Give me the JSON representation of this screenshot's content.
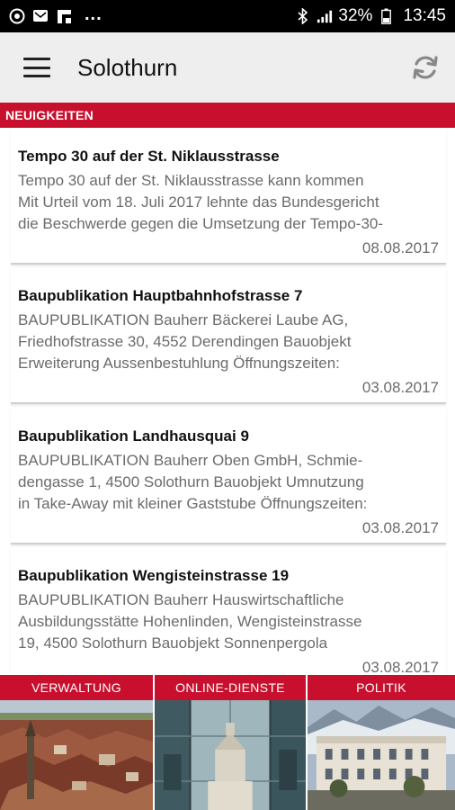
{
  "status_bar": {
    "battery": "32%",
    "time": "13:45",
    "more": "..."
  },
  "app_bar": {
    "title": "Solothurn"
  },
  "section": {
    "label": "NEUIGKEITEN"
  },
  "news": [
    {
      "title": "Tempo 30 auf der St. Niklausstrasse",
      "excerpt": [
        "Tempo 30 auf der St. Niklausstrasse kann kommen",
        "Mit Urteil vom 18. Juli 2017 lehnte das Bundesgericht",
        "die Beschwerde gegen die Umsetzung der Tempo-30-"
      ],
      "date": "08.08.2017"
    },
    {
      "title": "Baupublikation Hauptbahnhofstrasse 7",
      "excerpt": [
        "BAUPUBLIKATION  Bauherr Bäckerei Laube AG,",
        "Friedhofstrasse 30, 4552 Derendingen  Bauobjekt",
        "Erweiterung Aussenbestuhlung Öffnungszeiten:"
      ],
      "date": "03.08.2017"
    },
    {
      "title": "Baupublikation Landhausquai 9",
      "excerpt": [
        "BAUPUBLIKATION  Bauherr Oben GmbH, Schmie-",
        "dengasse 1, 4500 Solothurn  Bauobjekt Umnutzung",
        "in Take-Away mit kleiner Gaststube Öffnungszeiten:"
      ],
      "date": "03.08.2017"
    },
    {
      "title": "Baupublikation Wengisteinstrasse 19",
      "excerpt": [
        "BAUPUBLIKATION  Bauherr Hauswirtschaftliche",
        "Ausbildungsstätte Hohenlinden, Wengisteinstrasse",
        "19, 4500 Solothurn  Bauobjekt Sonnenpergola"
      ],
      "date": "03.08.2017"
    }
  ],
  "tiles": [
    {
      "label": "VERWALTUNG"
    },
    {
      "label": "ONLINE-DIENSTE"
    },
    {
      "label": "POLITIK"
    }
  ],
  "colors": {
    "accent": "#c8102e",
    "app_bar": "#eeeeee",
    "status_bar": "#000000"
  },
  "icons": {
    "status_left": [
      "sync-circle-icon",
      "message-icon",
      "flipboard-icon"
    ],
    "status_right": [
      "bluetooth-icon",
      "signal-icon",
      "battery-icon"
    ],
    "app_bar": [
      "hamburger-menu-icon",
      "refresh-icon"
    ]
  }
}
